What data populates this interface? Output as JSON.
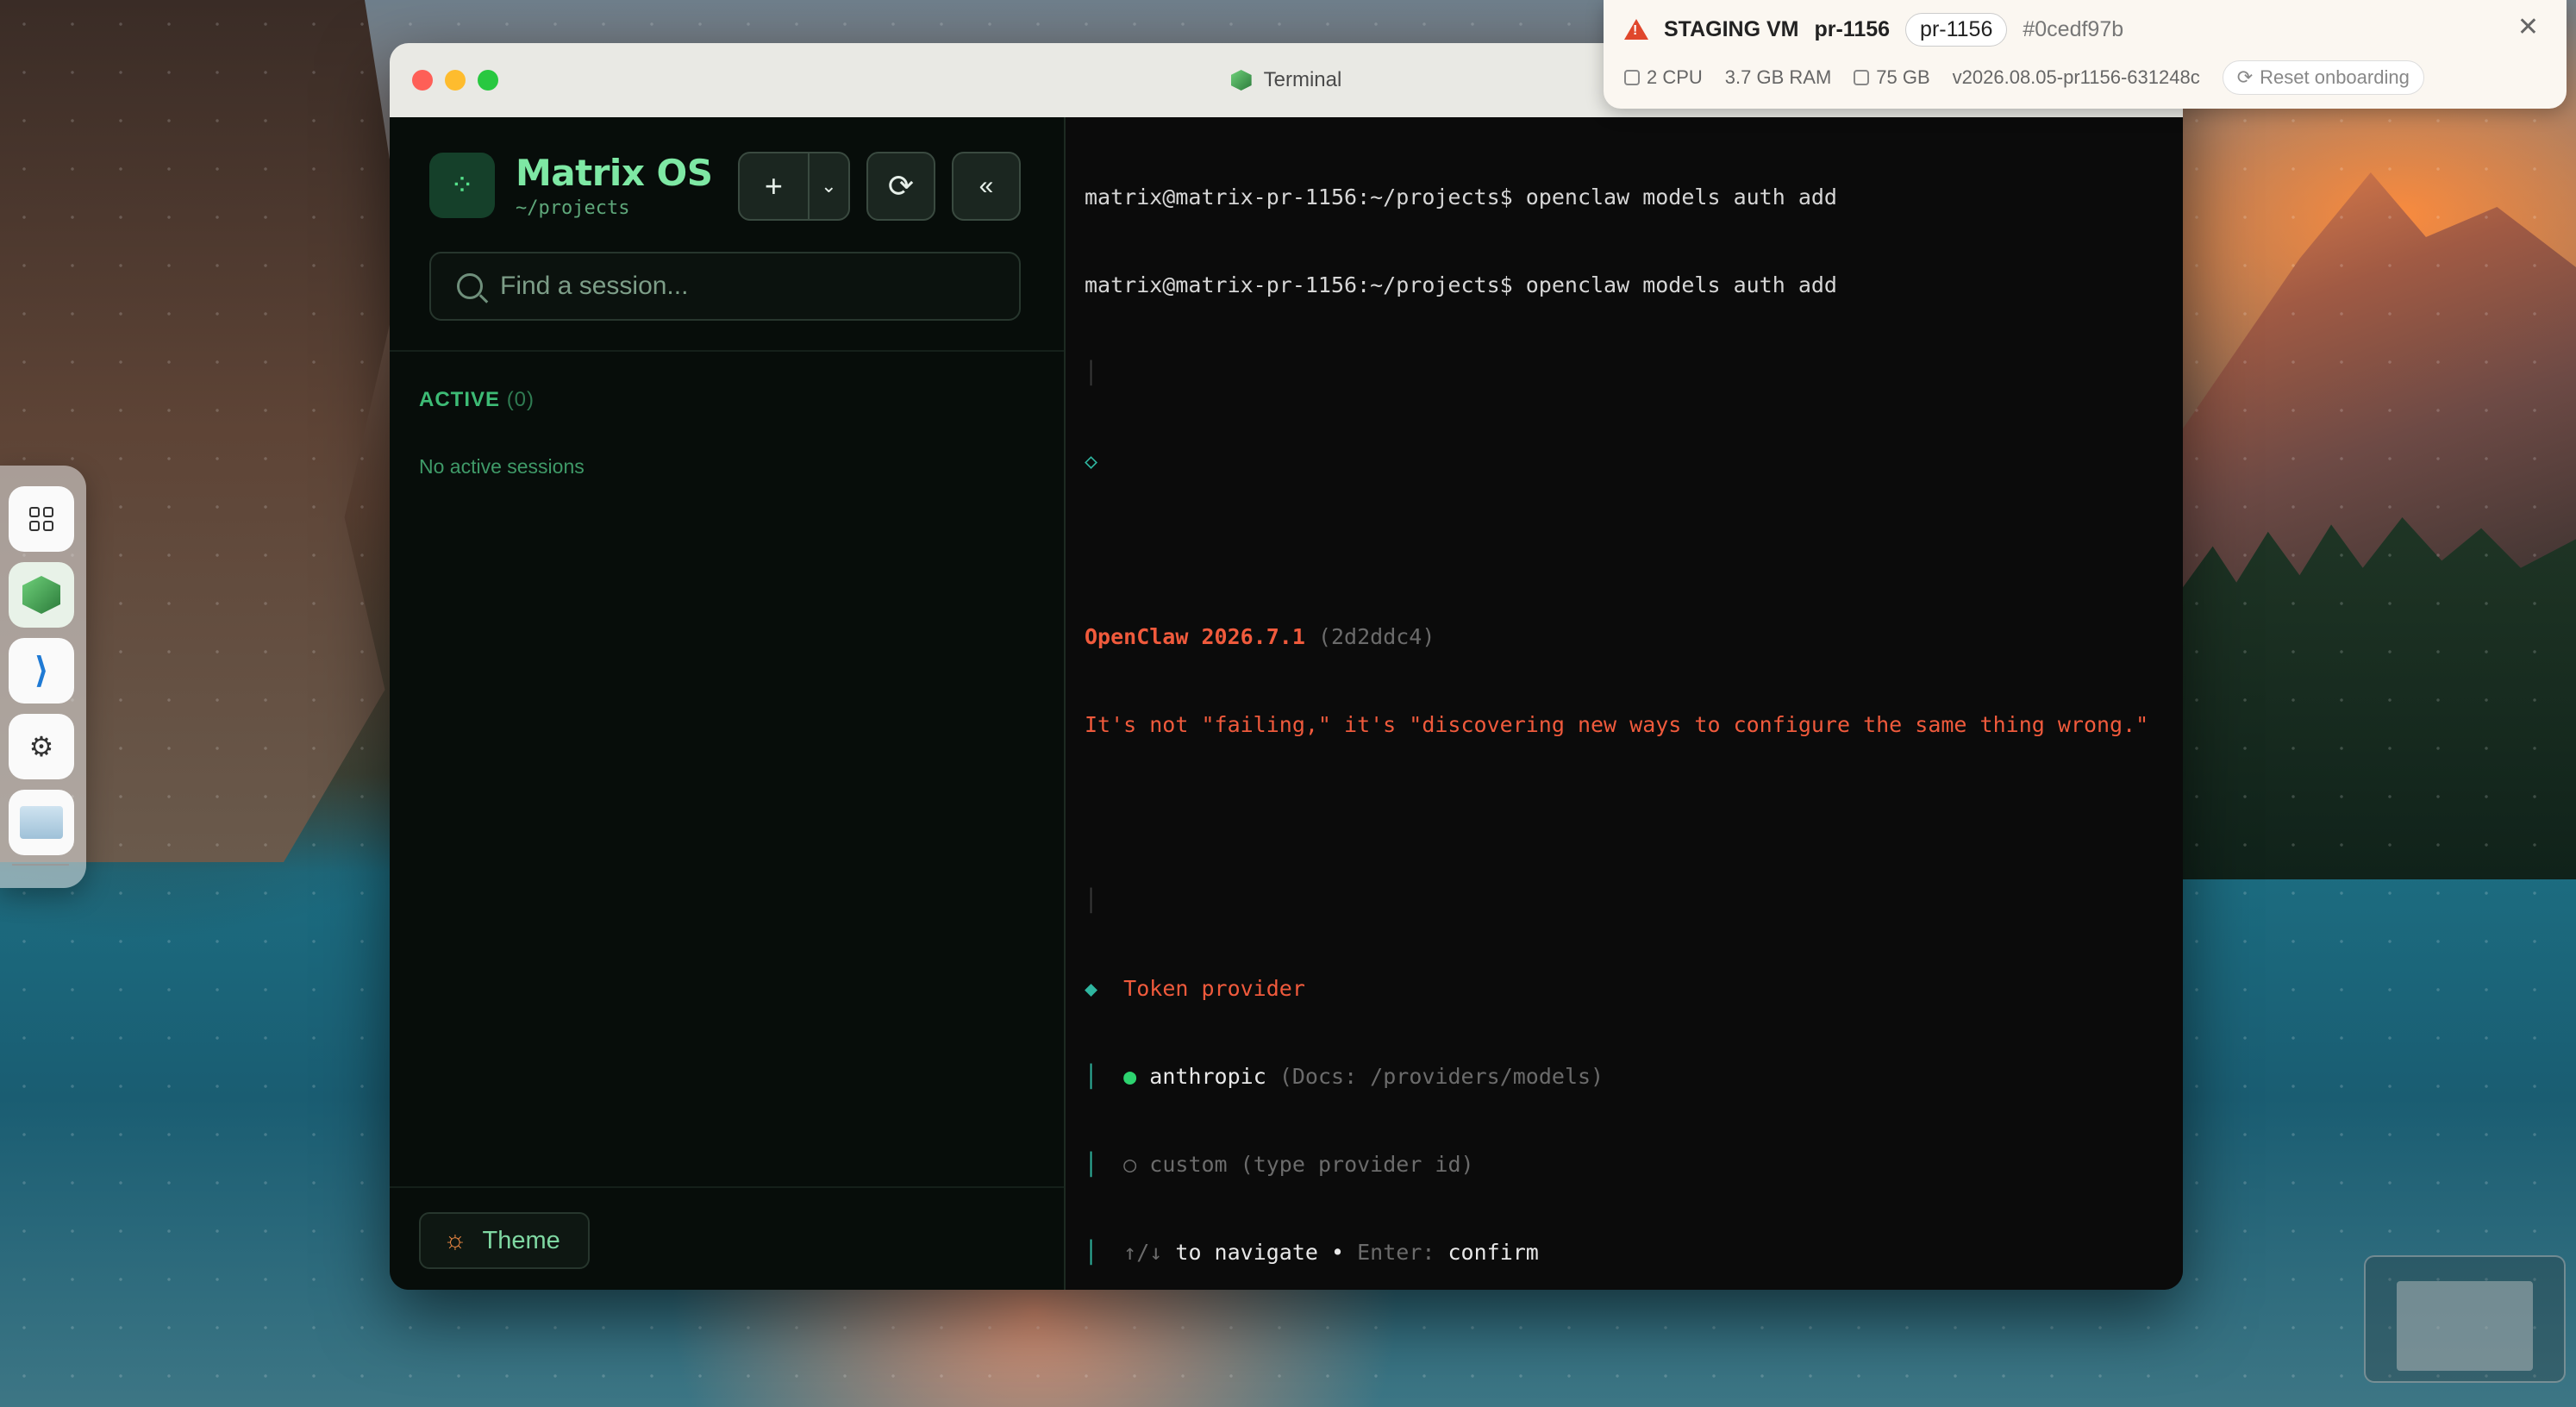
{
  "window": {
    "title": "Terminal"
  },
  "sidebar": {
    "brand_title": "Matrix OS",
    "brand_path": "~/projects",
    "search_placeholder": "Find a session...",
    "section_label": "ACTIVE",
    "section_count": "(0)",
    "empty_text": "No active sessions",
    "theme_label": "Theme"
  },
  "terminal": {
    "line1": "matrix@matrix-pr-1156:~/projects$ openclaw models auth add",
    "line2": "matrix@matrix-pr-1156:~/projects$ openclaw models auth add",
    "banner_name": "OpenClaw 2026.7.1",
    "banner_hash": "(2d2ddc4)",
    "tagline": "It's not \"failing,\" it's \"discovering new ways to configure the same thing wrong.\"",
    "prompt_title": "Token provider",
    "option1_name": "anthropic",
    "option1_hint": "(Docs: /providers/models)",
    "option2": "custom (type provider id)",
    "nav_keys": "↑/↓",
    "nav_text": "to navigate •",
    "enter_key": "Enter:",
    "enter_text": "confirm"
  },
  "staging": {
    "label": "STAGING VM",
    "pr": "pr-1156",
    "pr_pill": "pr-1156",
    "hash": "#0cedf97b",
    "cpu": "2 CPU",
    "ram": "3.7 GB RAM",
    "disk": "75 GB",
    "version": "v2026.08.05-pr1156-631248c",
    "reset": "Reset onboarding"
  },
  "icons": {
    "warning": "warning-icon",
    "close": "close-icon",
    "search": "search-icon",
    "theme": "sun-icon"
  },
  "colors": {
    "accent": "#7ee8a4",
    "terminal_orange": "#f05a3c",
    "selected_dot": "#2dd36f"
  }
}
